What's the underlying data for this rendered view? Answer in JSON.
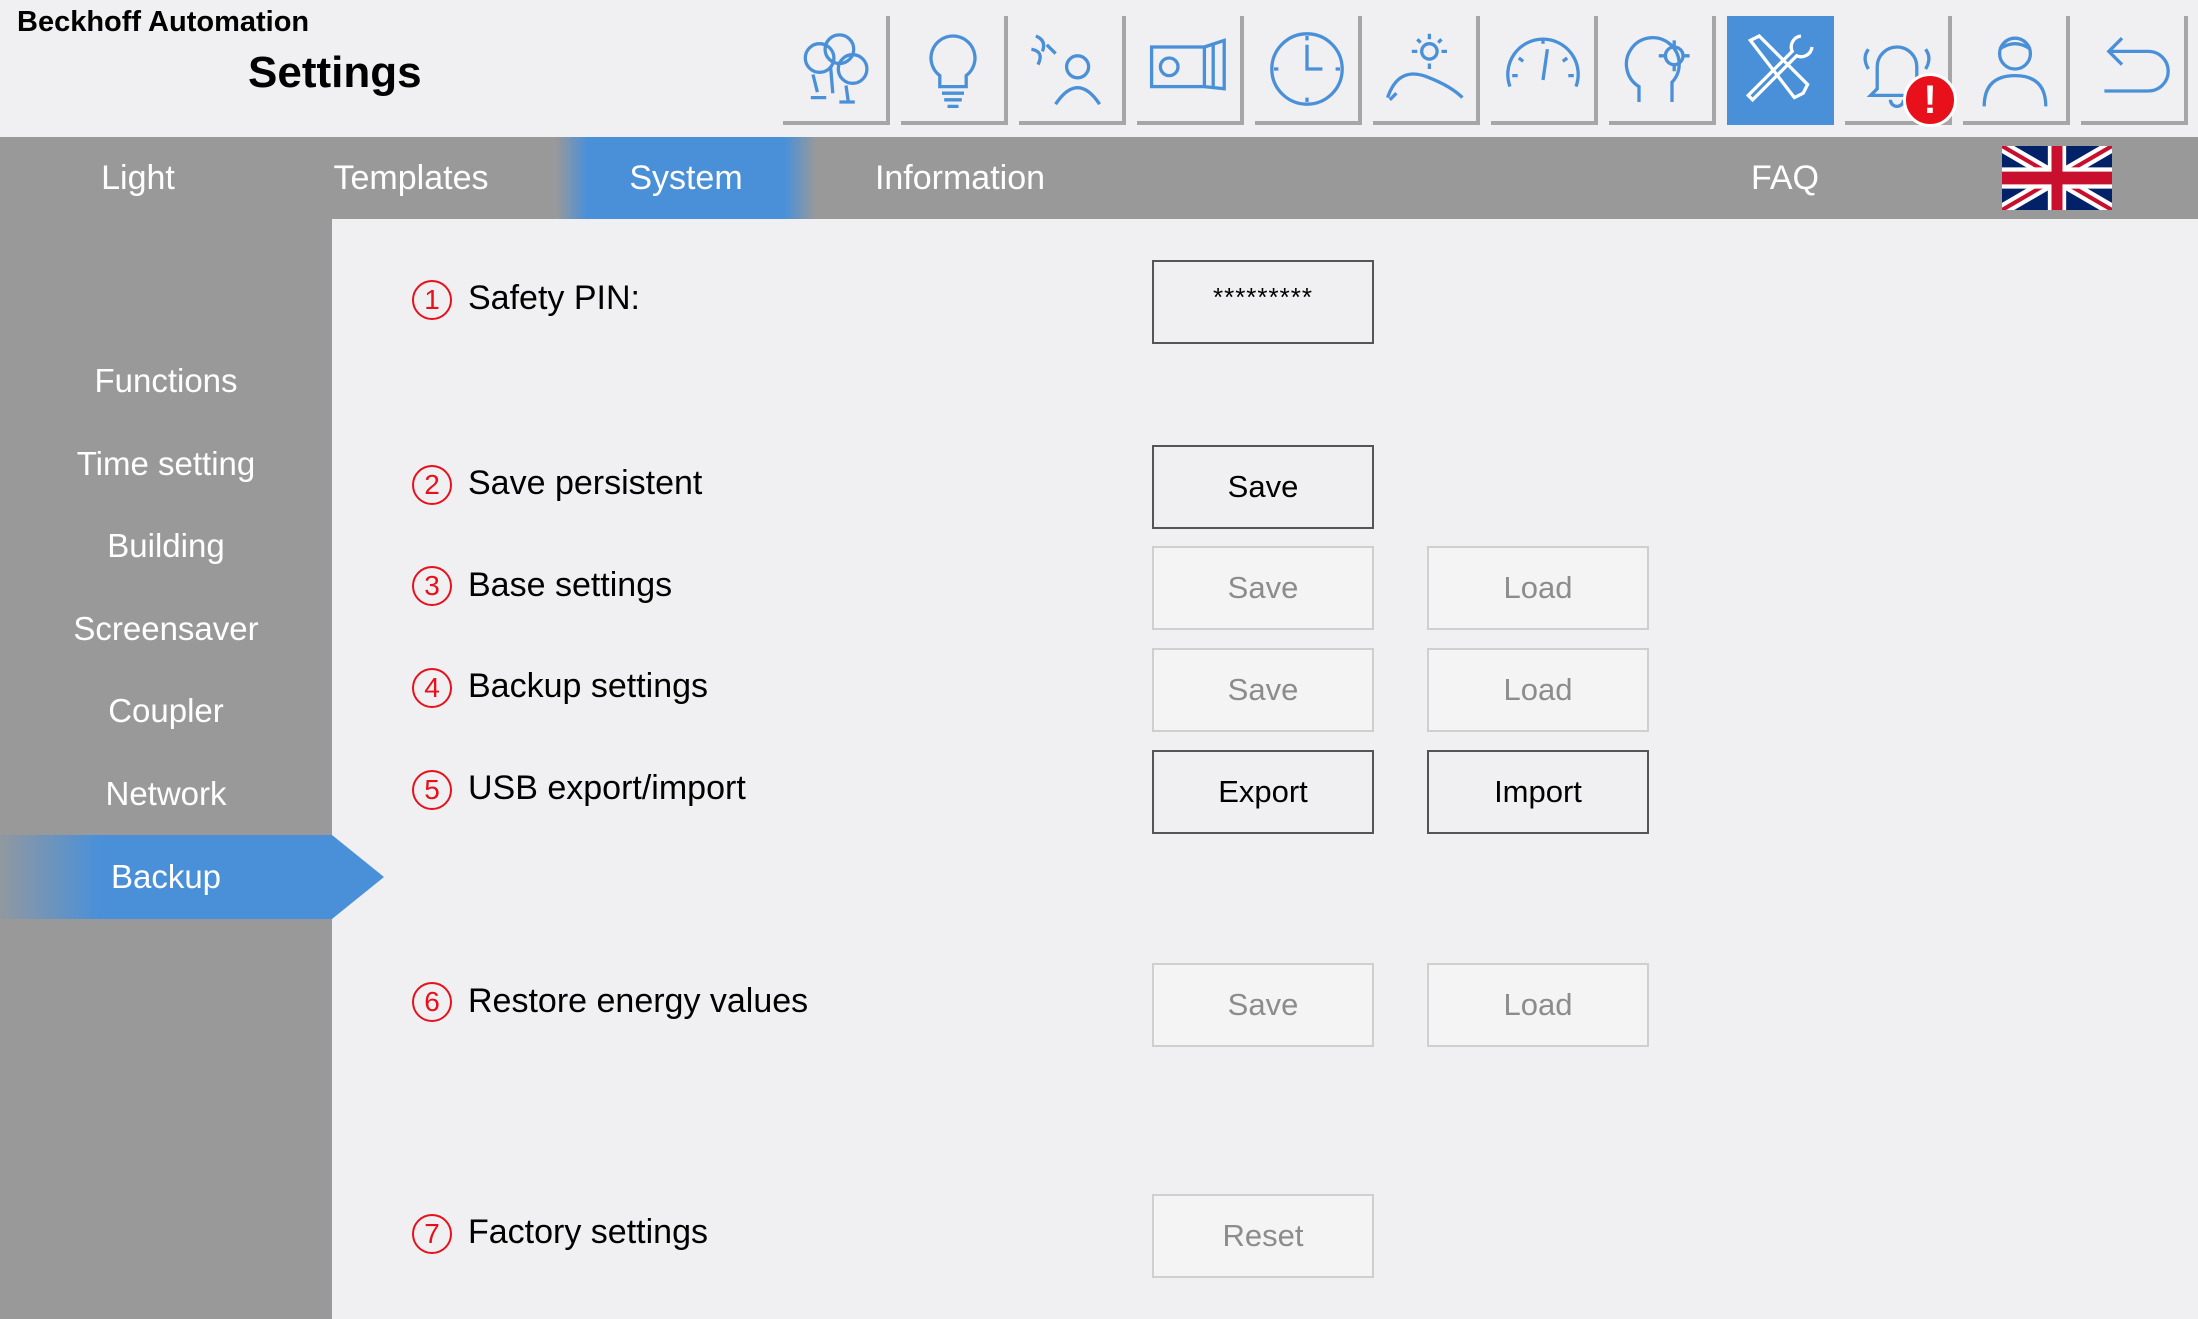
{
  "header": {
    "company": "Beckhoff Automation",
    "title": "Settings",
    "toolbar_icons": [
      "light-groups-icon",
      "lightbulb-icon",
      "presence-sensor-icon",
      "window-blind-icon",
      "clock-icon",
      "daylight-icon",
      "gauge-icon",
      "head-gear-icon",
      "tools-icon",
      "alarm-bell-icon",
      "user-icon",
      "back-arrow-icon"
    ],
    "active_icon": "tools-icon",
    "alarm_badge": "!"
  },
  "topnav": {
    "tabs": [
      "Light",
      "Templates",
      "System",
      "Information",
      "FAQ"
    ],
    "active_tab": "System",
    "language_flag": "uk-flag-icon"
  },
  "sidebar": {
    "items": [
      "Functions",
      "Time setting",
      "Building",
      "Screensaver",
      "Coupler",
      "Network",
      "Backup"
    ],
    "active_item": "Backup"
  },
  "main": {
    "rows": [
      {
        "num": "1",
        "label": "Safety PIN:",
        "pin_value": "*********"
      },
      {
        "num": "2",
        "label": "Save persistent",
        "buttons": [
          {
            "label": "Save",
            "enabled": true
          }
        ]
      },
      {
        "num": "3",
        "label": "Base settings",
        "buttons": [
          {
            "label": "Save",
            "enabled": false
          },
          {
            "label": "Load",
            "enabled": false
          }
        ]
      },
      {
        "num": "4",
        "label": "Backup settings",
        "buttons": [
          {
            "label": "Save",
            "enabled": false
          },
          {
            "label": "Load",
            "enabled": false
          }
        ]
      },
      {
        "num": "5",
        "label": "USB export/import",
        "buttons": [
          {
            "label": "Export",
            "enabled": true
          },
          {
            "label": "Import",
            "enabled": true
          }
        ]
      },
      {
        "num": "6",
        "label": "Restore energy values",
        "buttons": [
          {
            "label": "Save",
            "enabled": false
          },
          {
            "label": "Load",
            "enabled": false
          }
        ]
      },
      {
        "num": "7",
        "label": "Factory settings",
        "buttons": [
          {
            "label": "Reset",
            "enabled": false
          }
        ]
      }
    ]
  },
  "colors": {
    "accent": "#4a90d9",
    "nav_gray": "#999999",
    "background": "#f0f0f2",
    "marker_red": "#e8101a",
    "icon_blue": "#4a90d9"
  }
}
